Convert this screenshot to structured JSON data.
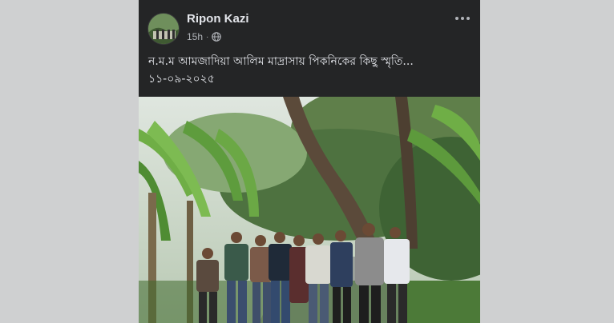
{
  "post": {
    "author_name": "Ripon Kazi",
    "time_label": "15h",
    "separator": "·",
    "privacy_icon": "globe-icon",
    "more_icon": "more-options-icon",
    "caption_line1": "ন.ম.ম আমজাদিয়া আলিম মাদ্রাসায় পিকনিকের কিছু স্মৃতি...",
    "caption_line2": "১১-০৯-২০২৫",
    "photo_subject": "group-photo"
  },
  "colors": {
    "card_bg": "#242526",
    "page_bg": "#cfd0d1",
    "primary_text": "#e4e6eb",
    "secondary_text": "#b0b3b8"
  }
}
